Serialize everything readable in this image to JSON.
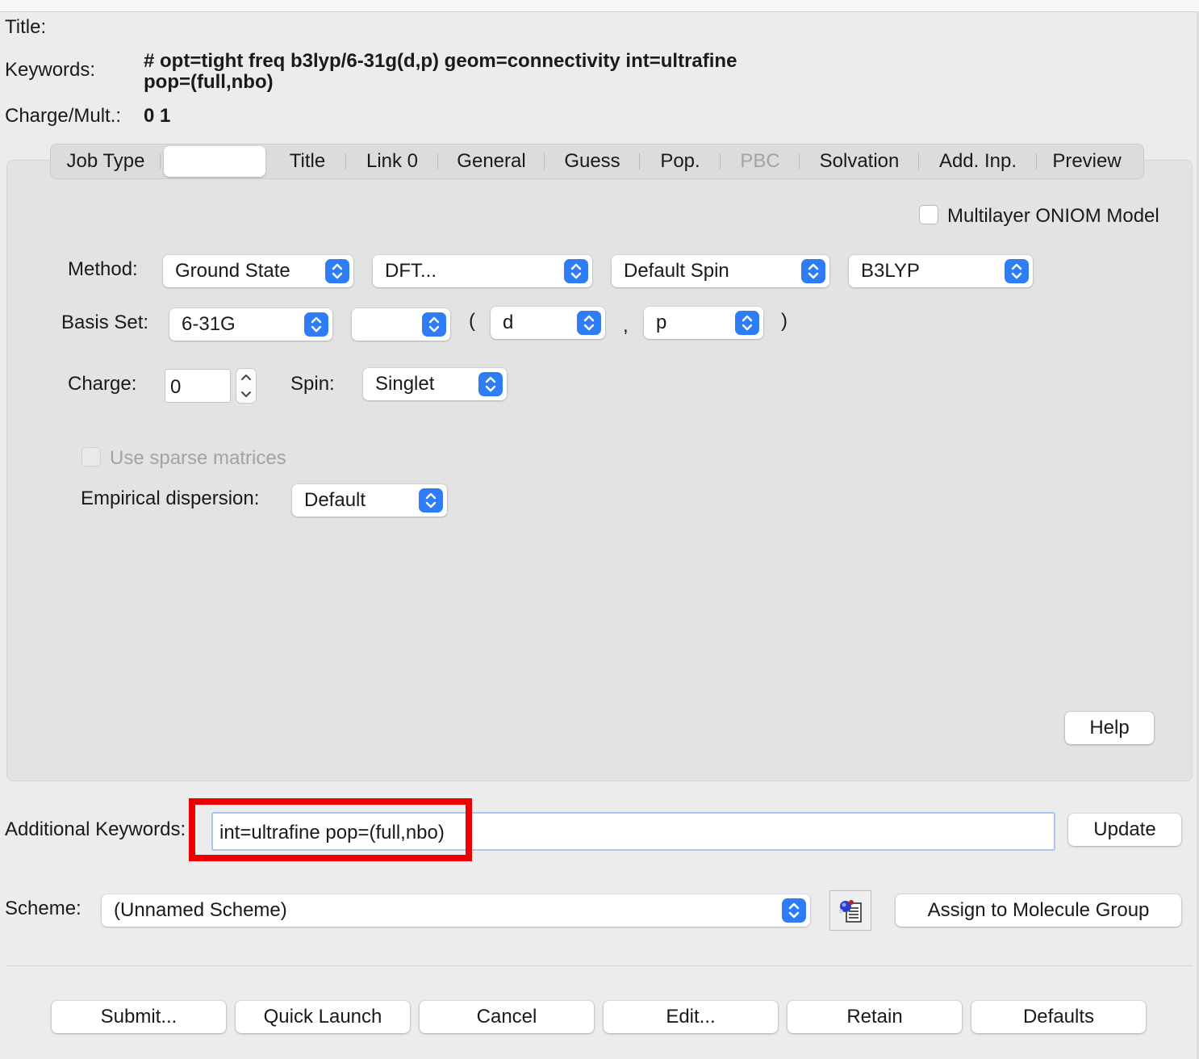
{
  "header": {
    "title_label": "Title:",
    "keywords_label": "Keywords:",
    "keywords_line1": "# opt=tight freq b3lyp/6-31g(d,p) geom=connectivity int=ultrafine",
    "keywords_line2": "pop=(full,nbo)",
    "charge_mult_label": "Charge/Mult.:",
    "charge_mult_value": "0 1"
  },
  "tabs": [
    {
      "label": "Job Type"
    },
    {
      "label": ""
    },
    {
      "label": "Title"
    },
    {
      "label": "Link 0"
    },
    {
      "label": "General"
    },
    {
      "label": "Guess"
    },
    {
      "label": "Pop."
    },
    {
      "label": "PBC"
    },
    {
      "label": "Solvation"
    },
    {
      "label": "Add. Inp."
    },
    {
      "label": "Preview"
    }
  ],
  "method_panel": {
    "oniom_label": "Multilayer ONIOM Model",
    "method_label": "Method:",
    "method_state": "Ground State",
    "method_type": "DFT...",
    "method_spin": "Default Spin",
    "method_functional": "B3LYP",
    "basis_label": "Basis Set:",
    "basis_value": "6-31G",
    "basis_extra": "",
    "open_paren": "(",
    "basis_pol1": "d",
    "comma": ",",
    "basis_pol2": "p",
    "close_paren": ")",
    "charge_label": "Charge:",
    "charge_value": "0",
    "spin_label": "Spin:",
    "spin_value": "Singlet",
    "sparse_label": "Use sparse matrices",
    "dispersion_label": "Empirical dispersion:",
    "dispersion_value": "Default",
    "help_label": "Help"
  },
  "additional": {
    "label": "Additional Keywords:",
    "value": "int=ultrafine pop=(full,nbo)",
    "update_label": "Update"
  },
  "scheme": {
    "label": "Scheme:",
    "value": "(Unnamed Scheme)",
    "assign_label": "Assign to Molecule Group"
  },
  "footer": {
    "submit": "Submit...",
    "quick_launch": "Quick Launch",
    "cancel": "Cancel",
    "edit": "Edit...",
    "retain": "Retain",
    "defaults": "Defaults"
  },
  "colors": {
    "accent": "#2f7df6",
    "highlight": "#ef0000",
    "background": "#ececec"
  },
  "icons": {
    "scheme_icon": "molecule-document-icon"
  }
}
